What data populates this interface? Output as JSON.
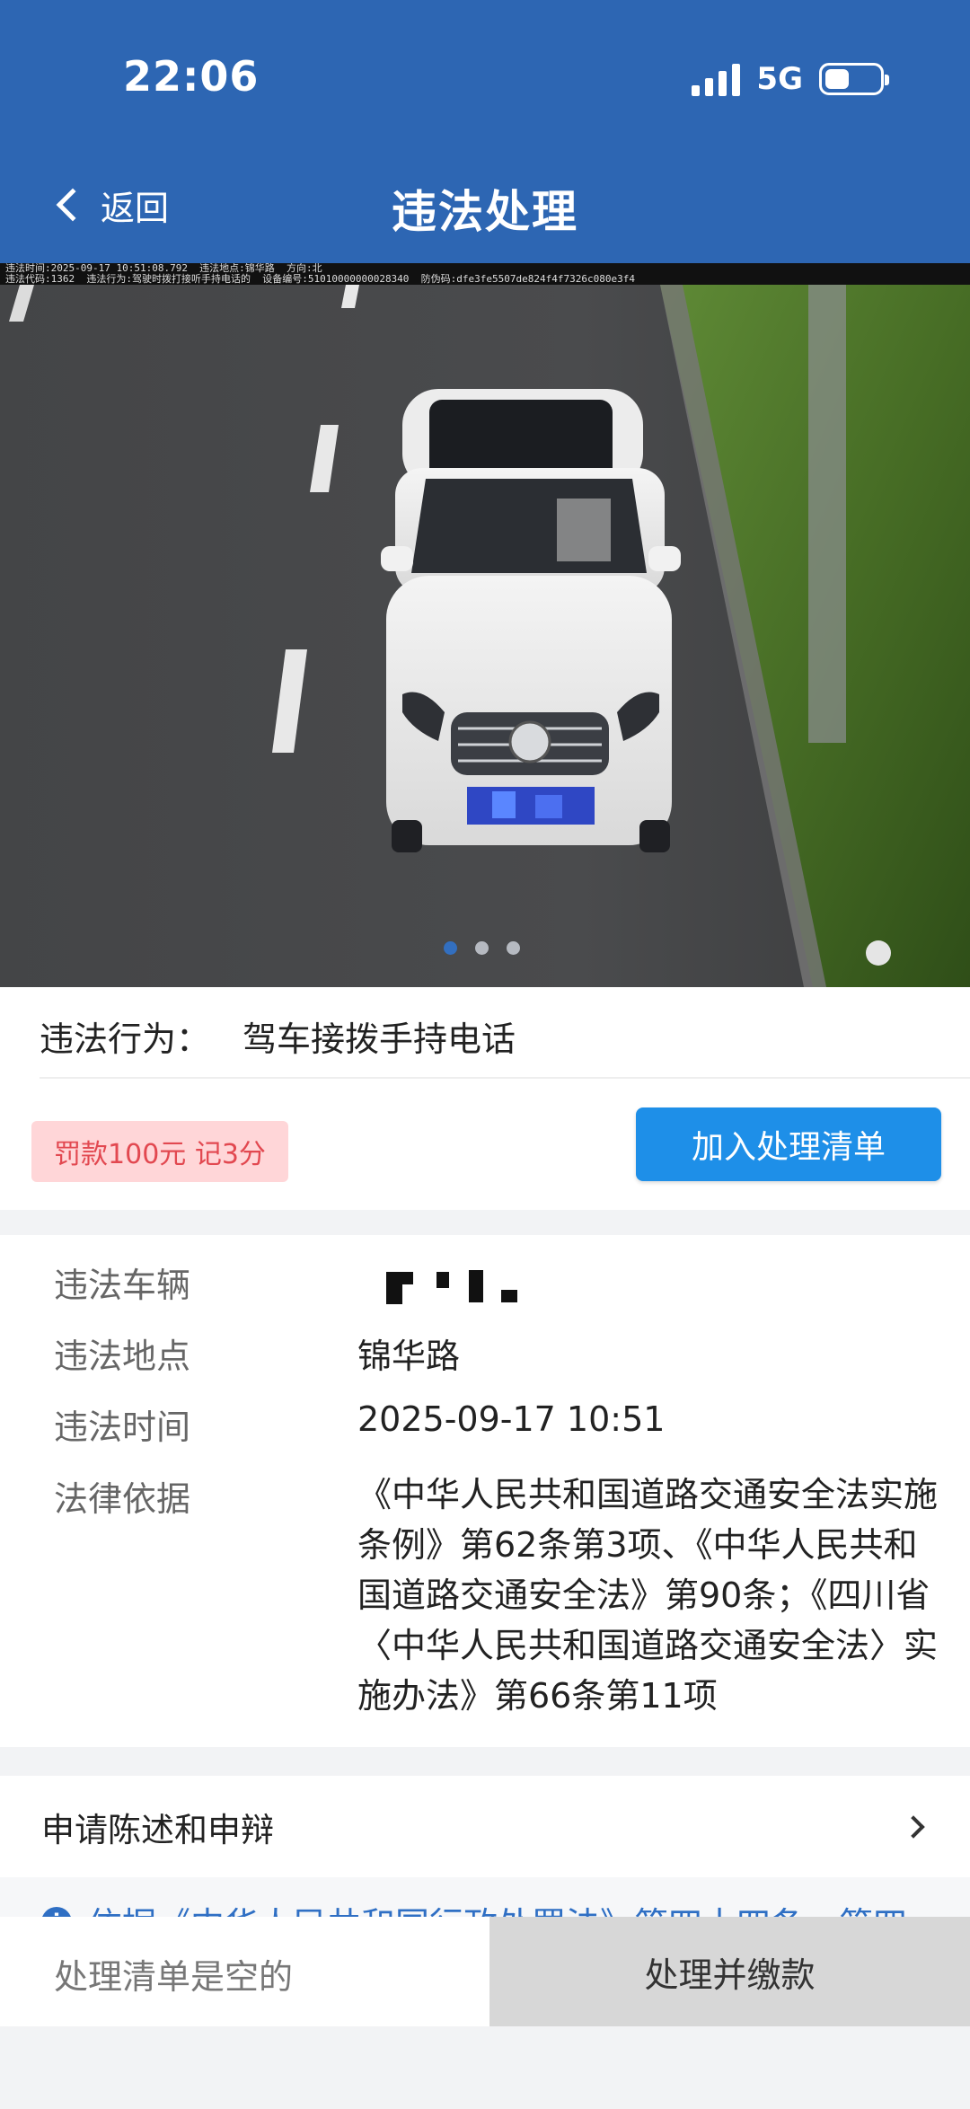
{
  "status": {
    "time": "22:06",
    "network": "5G",
    "battery_level": 0.3
  },
  "header": {
    "back_label": "返回",
    "title": "违法处理"
  },
  "photo": {
    "caption_line1": "违法时间:2025-09-17 10:51:08.792  违法地点:锦华路  方向:北",
    "caption_line2": "违法代码:1362  违法行为:驾驶时拨打接听手持电话的  设备编号:51010000000028340  防伪码:dfe3fe5507de824f4f7326c080e3f4",
    "slide_count": 3,
    "active_slide": 0
  },
  "violation": {
    "behavior_label": "违法行为：",
    "behavior_value": "驾车接拨手持电话",
    "fine_tag": "罚款100元 记3分",
    "add_button": "加入处理清单"
  },
  "details": {
    "vehicle_label": "违法车辆",
    "location_label": "违法地点",
    "location_value": "锦华路",
    "time_label": "违法时间",
    "time_value": "2025-09-17 10:51",
    "law_label": "法律依据",
    "law_value": "《中华人民共和国道路交通安全法实施条例》第62条第3项、《中华人民共和国道路交通安全法》第90条；《四川省〈中华人民共和国道路交通安全法〉实施办法》第66条第11项"
  },
  "appeal": {
    "label": "申请陈述和申辩"
  },
  "notice": {
    "text": "依据《中华人民共和国行政处罚法》第四十四条、第四"
  },
  "bottom": {
    "empty_text": "处理清单是空的",
    "pay_button": "处理并缴款"
  },
  "colors": {
    "header": "#2d66b3",
    "primary_button": "#1e8fe8",
    "fine_tag_bg": "#ffd6d8",
    "fine_tag_text": "#e24850",
    "link": "#2f6fc4"
  }
}
